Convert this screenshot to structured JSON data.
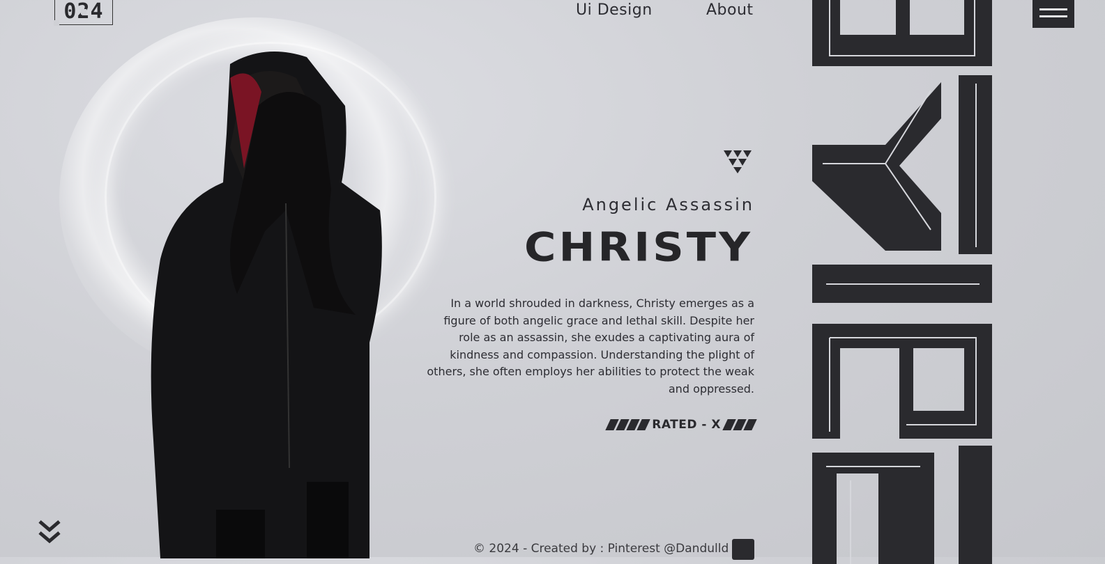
{
  "header": {
    "logo": "024",
    "nav": [
      {
        "label": "Ui Design"
      },
      {
        "label": "About"
      }
    ]
  },
  "hero": {
    "subtitle": "Angelic Assassin",
    "title": "CHRISTY",
    "description": "In a world shrouded in darkness, Christy emerges as a figure of both angelic grace and lethal skill. Despite her role as an assassin, she exudes a captivating aura of kindness and compassion. Understanding the plight of others, she often employs her abilities to protect the weak and oppressed.",
    "rating": "RATED - X"
  },
  "footer": {
    "credit": "© 2024 - Created by : Pinterest @Dandulld"
  },
  "icons": {
    "menu": "hamburger-icon",
    "emblem": "triangle-emblem-icon",
    "scroll": "double-chevron-down-icon",
    "footer_logo": "brand-logo-icon"
  },
  "colors": {
    "background": "#cfd0d5",
    "ink": "#2a2a2e",
    "accent_red": "#8b1a2b"
  }
}
